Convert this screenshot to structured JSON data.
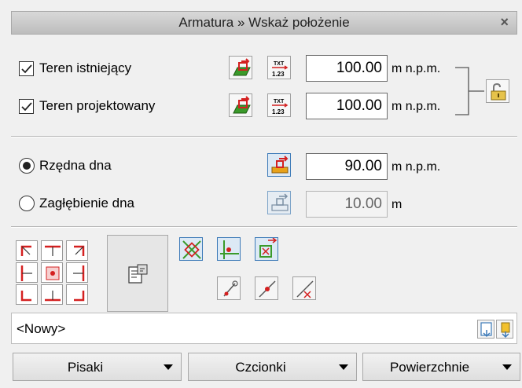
{
  "window": {
    "title": "Armatura » Wskaż położenie",
    "close_glyph": "×"
  },
  "terrain": {
    "existing": {
      "label": "Teren istniejący",
      "checked": true,
      "value": "100.00",
      "unit": "m n.p.m."
    },
    "designed": {
      "label": "Teren projektowany",
      "checked": true,
      "value": "100.00",
      "unit": "m n.p.m."
    },
    "icons": [
      "pick-terrain-icon",
      "text-value-icon",
      "lock-icon"
    ]
  },
  "bottom": {
    "ordinate": {
      "label": "Rzędna dna",
      "selected": true,
      "value": "90.00",
      "unit": "m n.p.m."
    },
    "depth": {
      "label": "Zagłębienie dna",
      "selected": false,
      "value": "10.00",
      "unit": "m"
    }
  },
  "toolbar": {
    "icons": [
      "anchor-grid-icon",
      "properties-icon",
      "snap-intersection-icon",
      "snap-point-icon",
      "snap-box-icon",
      "snap-end-icon",
      "snap-line-icon",
      "snap-cut-icon"
    ]
  },
  "style_combo": {
    "value": "<Nowy>",
    "icons": [
      "new-style-icon",
      "save-style-icon"
    ]
  },
  "buttons": {
    "pens": "Pisaki",
    "fonts": "Czcionki",
    "surfaces": "Powierzchnie"
  },
  "colors": {
    "accent": "#3d7ab8",
    "icon_green": "#3a9a2a",
    "icon_red": "#d42020",
    "icon_orange": "#e8a21a"
  }
}
